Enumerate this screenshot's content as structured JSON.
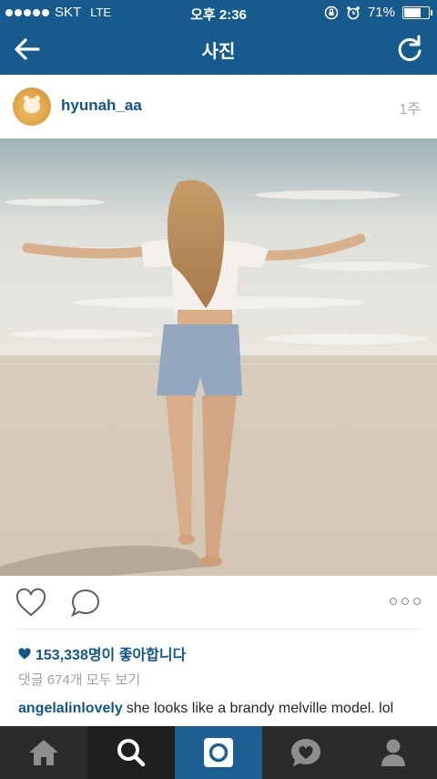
{
  "status_bar": {
    "carrier": "SKT",
    "network": "LTE",
    "time": "오후 2:36",
    "battery": "71%",
    "battery_level": 0.71
  },
  "nav": {
    "title": "사진",
    "back_icon": "arrow-left-icon",
    "refresh_icon": "refresh-icon"
  },
  "post": {
    "username": "hyunah_aa",
    "time_ago": "1주",
    "likes_text": "153,338명이 좋아합니다",
    "comments_link": "댓글 674개 모두 보기",
    "caption_user": "angelalinlovely",
    "caption_text": "she looks like a brandy melville model. lol"
  },
  "actions": {
    "like_icon": "heart-outline-icon",
    "comment_icon": "comment-bubble-icon",
    "more_icon": "more-dots-icon"
  },
  "tabbar": {
    "items": [
      "home-icon",
      "search-icon",
      "camera-icon",
      "activity-heart-icon",
      "profile-icon"
    ],
    "active_index": 2
  },
  "colors": {
    "header": "#175a8e",
    "link": "#125688",
    "tab_active": "#1e5f92",
    "tabbar": "#2a2a2a"
  }
}
